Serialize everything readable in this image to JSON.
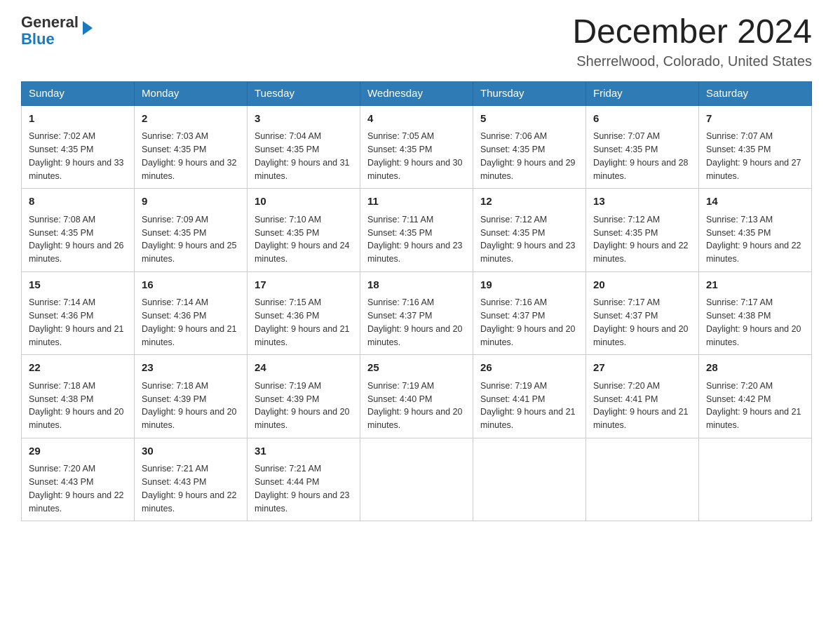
{
  "header": {
    "logo_general": "General",
    "logo_blue": "Blue",
    "month_title": "December 2024",
    "location": "Sherrelwood, Colorado, United States"
  },
  "weekdays": [
    "Sunday",
    "Monday",
    "Tuesday",
    "Wednesday",
    "Thursday",
    "Friday",
    "Saturday"
  ],
  "weeks": [
    [
      {
        "day": "1",
        "sunrise": "Sunrise: 7:02 AM",
        "sunset": "Sunset: 4:35 PM",
        "daylight": "Daylight: 9 hours and 33 minutes."
      },
      {
        "day": "2",
        "sunrise": "Sunrise: 7:03 AM",
        "sunset": "Sunset: 4:35 PM",
        "daylight": "Daylight: 9 hours and 32 minutes."
      },
      {
        "day": "3",
        "sunrise": "Sunrise: 7:04 AM",
        "sunset": "Sunset: 4:35 PM",
        "daylight": "Daylight: 9 hours and 31 minutes."
      },
      {
        "day": "4",
        "sunrise": "Sunrise: 7:05 AM",
        "sunset": "Sunset: 4:35 PM",
        "daylight": "Daylight: 9 hours and 30 minutes."
      },
      {
        "day": "5",
        "sunrise": "Sunrise: 7:06 AM",
        "sunset": "Sunset: 4:35 PM",
        "daylight": "Daylight: 9 hours and 29 minutes."
      },
      {
        "day": "6",
        "sunrise": "Sunrise: 7:07 AM",
        "sunset": "Sunset: 4:35 PM",
        "daylight": "Daylight: 9 hours and 28 minutes."
      },
      {
        "day": "7",
        "sunrise": "Sunrise: 7:07 AM",
        "sunset": "Sunset: 4:35 PM",
        "daylight": "Daylight: 9 hours and 27 minutes."
      }
    ],
    [
      {
        "day": "8",
        "sunrise": "Sunrise: 7:08 AM",
        "sunset": "Sunset: 4:35 PM",
        "daylight": "Daylight: 9 hours and 26 minutes."
      },
      {
        "day": "9",
        "sunrise": "Sunrise: 7:09 AM",
        "sunset": "Sunset: 4:35 PM",
        "daylight": "Daylight: 9 hours and 25 minutes."
      },
      {
        "day": "10",
        "sunrise": "Sunrise: 7:10 AM",
        "sunset": "Sunset: 4:35 PM",
        "daylight": "Daylight: 9 hours and 24 minutes."
      },
      {
        "day": "11",
        "sunrise": "Sunrise: 7:11 AM",
        "sunset": "Sunset: 4:35 PM",
        "daylight": "Daylight: 9 hours and 23 minutes."
      },
      {
        "day": "12",
        "sunrise": "Sunrise: 7:12 AM",
        "sunset": "Sunset: 4:35 PM",
        "daylight": "Daylight: 9 hours and 23 minutes."
      },
      {
        "day": "13",
        "sunrise": "Sunrise: 7:12 AM",
        "sunset": "Sunset: 4:35 PM",
        "daylight": "Daylight: 9 hours and 22 minutes."
      },
      {
        "day": "14",
        "sunrise": "Sunrise: 7:13 AM",
        "sunset": "Sunset: 4:35 PM",
        "daylight": "Daylight: 9 hours and 22 minutes."
      }
    ],
    [
      {
        "day": "15",
        "sunrise": "Sunrise: 7:14 AM",
        "sunset": "Sunset: 4:36 PM",
        "daylight": "Daylight: 9 hours and 21 minutes."
      },
      {
        "day": "16",
        "sunrise": "Sunrise: 7:14 AM",
        "sunset": "Sunset: 4:36 PM",
        "daylight": "Daylight: 9 hours and 21 minutes."
      },
      {
        "day": "17",
        "sunrise": "Sunrise: 7:15 AM",
        "sunset": "Sunset: 4:36 PM",
        "daylight": "Daylight: 9 hours and 21 minutes."
      },
      {
        "day": "18",
        "sunrise": "Sunrise: 7:16 AM",
        "sunset": "Sunset: 4:37 PM",
        "daylight": "Daylight: 9 hours and 20 minutes."
      },
      {
        "day": "19",
        "sunrise": "Sunrise: 7:16 AM",
        "sunset": "Sunset: 4:37 PM",
        "daylight": "Daylight: 9 hours and 20 minutes."
      },
      {
        "day": "20",
        "sunrise": "Sunrise: 7:17 AM",
        "sunset": "Sunset: 4:37 PM",
        "daylight": "Daylight: 9 hours and 20 minutes."
      },
      {
        "day": "21",
        "sunrise": "Sunrise: 7:17 AM",
        "sunset": "Sunset: 4:38 PM",
        "daylight": "Daylight: 9 hours and 20 minutes."
      }
    ],
    [
      {
        "day": "22",
        "sunrise": "Sunrise: 7:18 AM",
        "sunset": "Sunset: 4:38 PM",
        "daylight": "Daylight: 9 hours and 20 minutes."
      },
      {
        "day": "23",
        "sunrise": "Sunrise: 7:18 AM",
        "sunset": "Sunset: 4:39 PM",
        "daylight": "Daylight: 9 hours and 20 minutes."
      },
      {
        "day": "24",
        "sunrise": "Sunrise: 7:19 AM",
        "sunset": "Sunset: 4:39 PM",
        "daylight": "Daylight: 9 hours and 20 minutes."
      },
      {
        "day": "25",
        "sunrise": "Sunrise: 7:19 AM",
        "sunset": "Sunset: 4:40 PM",
        "daylight": "Daylight: 9 hours and 20 minutes."
      },
      {
        "day": "26",
        "sunrise": "Sunrise: 7:19 AM",
        "sunset": "Sunset: 4:41 PM",
        "daylight": "Daylight: 9 hours and 21 minutes."
      },
      {
        "day": "27",
        "sunrise": "Sunrise: 7:20 AM",
        "sunset": "Sunset: 4:41 PM",
        "daylight": "Daylight: 9 hours and 21 minutes."
      },
      {
        "day": "28",
        "sunrise": "Sunrise: 7:20 AM",
        "sunset": "Sunset: 4:42 PM",
        "daylight": "Daylight: 9 hours and 21 minutes."
      }
    ],
    [
      {
        "day": "29",
        "sunrise": "Sunrise: 7:20 AM",
        "sunset": "Sunset: 4:43 PM",
        "daylight": "Daylight: 9 hours and 22 minutes."
      },
      {
        "day": "30",
        "sunrise": "Sunrise: 7:21 AM",
        "sunset": "Sunset: 4:43 PM",
        "daylight": "Daylight: 9 hours and 22 minutes."
      },
      {
        "day": "31",
        "sunrise": "Sunrise: 7:21 AM",
        "sunset": "Sunset: 4:44 PM",
        "daylight": "Daylight: 9 hours and 23 minutes."
      },
      null,
      null,
      null,
      null
    ]
  ]
}
